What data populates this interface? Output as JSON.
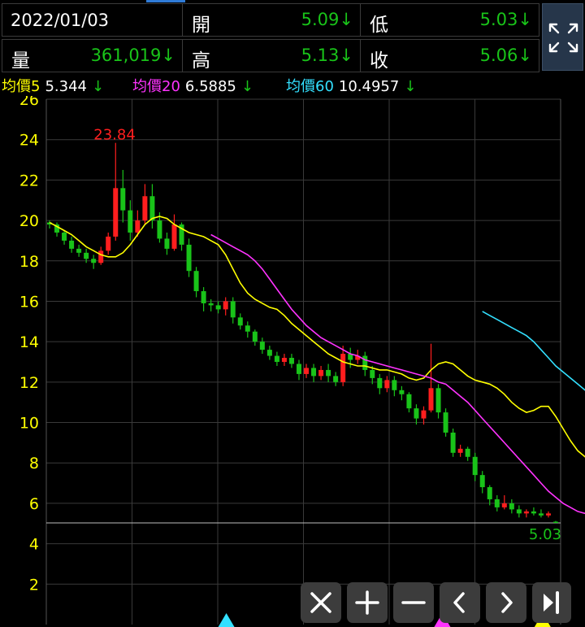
{
  "info": {
    "date": "2022/01/03",
    "open_label": "開",
    "open_value": "5.09↓",
    "low_label": "低",
    "low_value": "5.03↓",
    "volume_label": "量",
    "volume_value": "361,019↓",
    "high_label": "高",
    "high_value": "5.13↓",
    "close_label": "收",
    "close_value": "5.06↓"
  },
  "ma": [
    {
      "label": "均價5",
      "value": "5.344",
      "arrow": "↓",
      "color": "#ffff00"
    },
    {
      "label": "均價20",
      "value": "6.5885",
      "arrow": "↓",
      "color": "#ff33ff"
    },
    {
      "label": "均價60",
      "value": "10.4957",
      "arrow": "↓",
      "color": "#33e0ff"
    }
  ],
  "colors": {
    "up": "#ff1e1e",
    "down": "#19c319",
    "ma5": "#ffff00",
    "ma20": "#ff33ff",
    "ma60": "#33e0ff",
    "grid": "#3a3a3a",
    "axis_text": "#ffff00"
  },
  "chart_data": {
    "type": "candlestick",
    "ylim": [
      0,
      26
    ],
    "yticks": [
      2,
      4,
      6,
      8,
      10,
      12,
      14,
      16,
      18,
      20,
      22,
      24,
      26
    ],
    "max_label": {
      "text": "23.84",
      "value": 23.84
    },
    "min_label": {
      "text": "5.03",
      "value": 5.03
    },
    "reference_line": 5.03,
    "ma5": [
      19.9,
      19.7,
      19.5,
      19.3,
      19.0,
      18.7,
      18.5,
      18.3,
      18.2,
      18.2,
      18.4,
      18.8,
      19.3,
      19.8,
      20.1,
      20.2,
      20.1,
      19.8,
      19.6,
      19.4,
      19.3,
      19.2,
      19.0,
      18.8,
      18.3,
      17.6,
      16.9,
      16.4,
      16.1,
      15.9,
      15.7,
      15.6,
      15.3,
      14.9,
      14.6,
      14.3,
      14.0,
      13.7,
      13.4,
      13.2,
      13.0,
      12.9,
      12.8,
      12.8,
      12.7,
      12.6,
      12.6,
      12.5,
      12.4,
      12.2,
      12.1,
      12.2,
      12.6,
      12.9,
      13.0,
      12.9,
      12.6,
      12.3,
      12.1,
      12.0,
      11.9,
      11.7,
      11.4,
      11.0,
      10.7,
      10.5,
      10.6,
      10.8,
      10.8,
      10.3,
      9.7,
      9.1,
      8.6,
      8.3,
      8.0,
      7.5,
      6.9,
      6.4,
      6.0,
      5.8,
      5.6,
      5.5,
      5.5,
      5.5,
      5.4,
      5.3
    ],
    "ma20": {
      "start": 22,
      "values": [
        19.3,
        19.1,
        18.9,
        18.7,
        18.5,
        18.3,
        18.0,
        17.6,
        17.1,
        16.6,
        16.1,
        15.6,
        15.2,
        14.8,
        14.5,
        14.2,
        14.0,
        13.8,
        13.6,
        13.4,
        13.3,
        13.1,
        13.0,
        12.9,
        12.8,
        12.7,
        12.6,
        12.5,
        12.4,
        12.3,
        12.2,
        12.0,
        11.9,
        11.6,
        11.3,
        11.0,
        10.6,
        10.2,
        9.8,
        9.4,
        9.0,
        8.6,
        8.2,
        7.8,
        7.4,
        7.0,
        6.6,
        6.3,
        6.0,
        5.8,
        5.6,
        5.5,
        5.4,
        5.3
      ]
    },
    "ma60": {
      "start": 59,
      "values": [
        15.5,
        15.3,
        15.1,
        14.9,
        14.7,
        14.5,
        14.3,
        14.0,
        13.6,
        13.2,
        12.8,
        12.5,
        12.2,
        11.9,
        11.6,
        11.3,
        11.0,
        10.8,
        10.6,
        10.5
      ]
    },
    "candles": [
      [
        19.9,
        19.8,
        20.0,
        19.6
      ],
      [
        19.8,
        19.4,
        19.9,
        19.2
      ],
      [
        19.4,
        19.0,
        19.5,
        18.8
      ],
      [
        19.0,
        18.6,
        19.2,
        18.4
      ],
      [
        18.6,
        18.4,
        18.8,
        18.2
      ],
      [
        18.4,
        18.1,
        18.6,
        17.9
      ],
      [
        18.1,
        17.9,
        18.3,
        17.6
      ],
      [
        17.9,
        18.5,
        18.7,
        17.8
      ],
      [
        18.5,
        19.2,
        19.4,
        18.3
      ],
      [
        19.2,
        21.6,
        23.84,
        19.0
      ],
      [
        21.6,
        20.5,
        22.5,
        19.9
      ],
      [
        20.5,
        19.4,
        21.0,
        19.0
      ],
      [
        19.4,
        20.0,
        20.5,
        19.2
      ],
      [
        20.0,
        21.2,
        21.8,
        19.8
      ],
      [
        21.2,
        20.0,
        21.8,
        19.6
      ],
      [
        20.0,
        19.1,
        20.4,
        18.9
      ],
      [
        19.1,
        18.6,
        19.4,
        18.3
      ],
      [
        18.6,
        19.8,
        20.3,
        18.5
      ],
      [
        19.8,
        18.8,
        19.9,
        18.5
      ],
      [
        18.8,
        17.5,
        19.1,
        17.2
      ],
      [
        17.5,
        16.5,
        17.7,
        16.2
      ],
      [
        16.5,
        15.9,
        16.7,
        15.5
      ],
      [
        15.9,
        15.8,
        16.1,
        15.5
      ],
      [
        15.8,
        15.6,
        16.0,
        15.4
      ],
      [
        15.6,
        16.0,
        16.2,
        15.3
      ],
      [
        16.0,
        15.2,
        16.2,
        14.9
      ],
      [
        15.2,
        14.8,
        15.4,
        14.6
      ],
      [
        14.8,
        14.5,
        15.0,
        14.2
      ],
      [
        14.5,
        14.0,
        14.6,
        13.8
      ],
      [
        14.0,
        13.6,
        14.2,
        13.4
      ],
      [
        13.6,
        13.3,
        13.8,
        13.1
      ],
      [
        13.3,
        13.0,
        13.5,
        12.8
      ],
      [
        13.0,
        13.2,
        13.4,
        12.8
      ],
      [
        13.2,
        12.9,
        13.4,
        12.7
      ],
      [
        12.9,
        12.4,
        13.1,
        12.1
      ],
      [
        12.4,
        12.7,
        12.9,
        12.2
      ],
      [
        12.7,
        12.3,
        12.9,
        12.0
      ],
      [
        12.3,
        12.6,
        12.8,
        12.1
      ],
      [
        12.6,
        12.3,
        12.9,
        12.0
      ],
      [
        12.3,
        12.0,
        12.5,
        11.8
      ],
      [
        12.0,
        13.4,
        13.8,
        11.8
      ],
      [
        13.4,
        13.1,
        13.7,
        12.7
      ],
      [
        13.1,
        13.3,
        13.6,
        12.9
      ],
      [
        13.3,
        12.6,
        13.5,
        12.3
      ],
      [
        12.6,
        12.2,
        12.8,
        11.9
      ],
      [
        12.2,
        11.7,
        12.4,
        11.4
      ],
      [
        11.7,
        12.1,
        12.3,
        11.5
      ],
      [
        12.1,
        11.6,
        12.3,
        11.3
      ],
      [
        11.6,
        11.4,
        11.8,
        11.1
      ],
      [
        11.4,
        10.7,
        11.5,
        10.5
      ],
      [
        10.7,
        10.2,
        10.9,
        9.9
      ],
      [
        10.2,
        10.6,
        10.8,
        9.9
      ],
      [
        10.6,
        11.7,
        13.9,
        10.5
      ],
      [
        11.7,
        10.5,
        11.9,
        10.2
      ],
      [
        10.5,
        9.5,
        10.7,
        9.3
      ],
      [
        9.5,
        8.5,
        9.7,
        8.3
      ],
      [
        8.5,
        8.7,
        8.9,
        8.3
      ],
      [
        8.7,
        8.3,
        8.8,
        8.1
      ],
      [
        8.3,
        7.4,
        8.5,
        7.1
      ],
      [
        7.4,
        6.8,
        7.6,
        6.5
      ],
      [
        6.8,
        6.2,
        6.9,
        5.9
      ],
      [
        6.2,
        5.8,
        6.4,
        5.6
      ],
      [
        5.8,
        6.0,
        6.4,
        5.7
      ],
      [
        6.0,
        5.7,
        6.2,
        5.5
      ],
      [
        5.7,
        5.5,
        5.9,
        5.3
      ],
      [
        5.5,
        5.6,
        5.7,
        5.3
      ],
      [
        5.6,
        5.5,
        5.8,
        5.4
      ],
      [
        5.5,
        5.4,
        5.7,
        5.3
      ],
      [
        5.4,
        5.5,
        5.6,
        5.3
      ],
      [
        5.09,
        5.06,
        5.13,
        5.03
      ]
    ],
    "markers": [
      {
        "label": "cyan-triangle",
        "color": "#33e0ff",
        "xfrac": 0.35
      },
      {
        "label": "magenta-triangle",
        "color": "#ff33ff",
        "xfrac": 0.77
      },
      {
        "label": "yellow-triangle",
        "color": "#ffff00",
        "xfrac": 0.965
      }
    ]
  },
  "buttons": [
    {
      "name": "close-button",
      "icon": "close-icon"
    },
    {
      "name": "zoom-in-button",
      "icon": "plus-icon"
    },
    {
      "name": "zoom-out-button",
      "icon": "minus-icon"
    },
    {
      "name": "previous-button",
      "icon": "chevron-left-icon"
    },
    {
      "name": "next-button",
      "icon": "chevron-right-icon"
    },
    {
      "name": "jump-latest-button",
      "icon": "skip-end-icon"
    }
  ]
}
